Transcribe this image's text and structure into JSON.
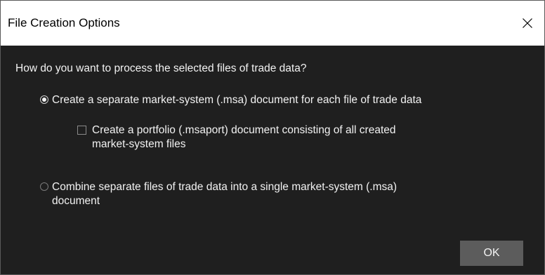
{
  "dialog": {
    "title": "File Creation Options",
    "close_icon": "close-icon",
    "question": "How do you want to process the selected files of trade data?",
    "options": [
      {
        "type": "radio",
        "selected": true,
        "label": "Create a separate market-system (.msa) document for each file of trade data"
      },
      {
        "type": "checkbox",
        "checked": false,
        "label_line1": "Create a portfolio (.msaport) document consisting of all created",
        "label_line2": "market-system files"
      },
      {
        "type": "radio",
        "selected": false,
        "label_line1": "Combine separate files of trade data into a single market-system (.msa)",
        "label_line2": "document"
      }
    ],
    "ok_label": "OK"
  }
}
